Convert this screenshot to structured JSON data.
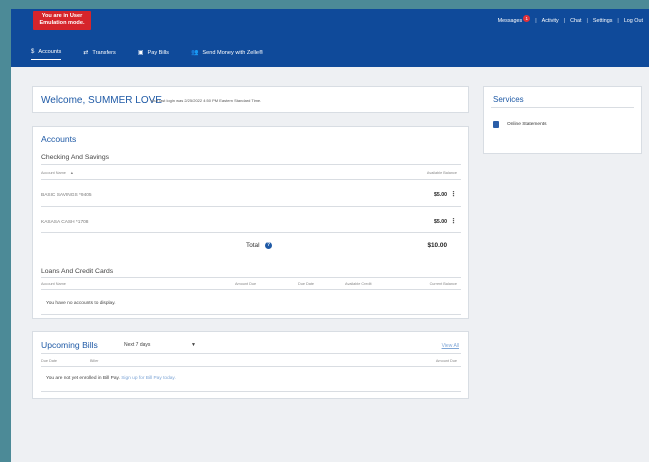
{
  "emulation_banner": "You are in User Emulation mode.",
  "topnav": {
    "messages": "Messages",
    "messages_count": "1",
    "activity": "Activity",
    "chat": "Chat",
    "settings": "Settings",
    "logout": "Log Out",
    "separator": "|"
  },
  "mainnav": [
    {
      "icon": "$",
      "label": "Accounts",
      "active": true
    },
    {
      "icon": "⇄",
      "label": "Transfers"
    },
    {
      "icon": "▣",
      "label": "Pay Bills"
    },
    {
      "icon": "👥",
      "label": "Send Money with Zelle®"
    }
  ],
  "welcome": {
    "title": "Welcome, SUMMER LOVE",
    "last_login": "Your last login was 2/25/2022 4:50 PM Eastern Standard Time."
  },
  "accounts": {
    "title": "Accounts",
    "checking_title": "Checking And Savings",
    "col_account_name": "Account Name",
    "col_sort_icon": "▲",
    "col_available": "Available Balance",
    "rows": [
      {
        "name": "BASIC SAVINGS *9405",
        "balance": "$5.00"
      },
      {
        "name": "KASASA CASH *1708",
        "balance": "$5.00"
      }
    ],
    "total_label": "Total",
    "total_value": "$10.00",
    "loans_title": "Loans And Credit Cards",
    "loan_cols": [
      "Account Name",
      "Amount Due",
      "Due Date",
      "Available Credit",
      "Current Balance"
    ],
    "no_accounts": "You have no accounts to display."
  },
  "bills": {
    "title": "Upcoming Bills",
    "period": "Next 7 days",
    "view_all": "View All",
    "cols": [
      "Due Date",
      "Biller",
      "Amount Due"
    ],
    "not_enrolled": "You are not yet enrolled in Bill Pay.",
    "signup_link": "Sign up for Bill Pay today."
  },
  "services": {
    "title": "Services",
    "items": [
      {
        "label": "Online Statements",
        "icon": "document-icon"
      }
    ]
  },
  "colors": {
    "brand_blue": "#0f4a9a",
    "emulation_red": "#d6252b",
    "title_blue": "#1f5aa6"
  }
}
